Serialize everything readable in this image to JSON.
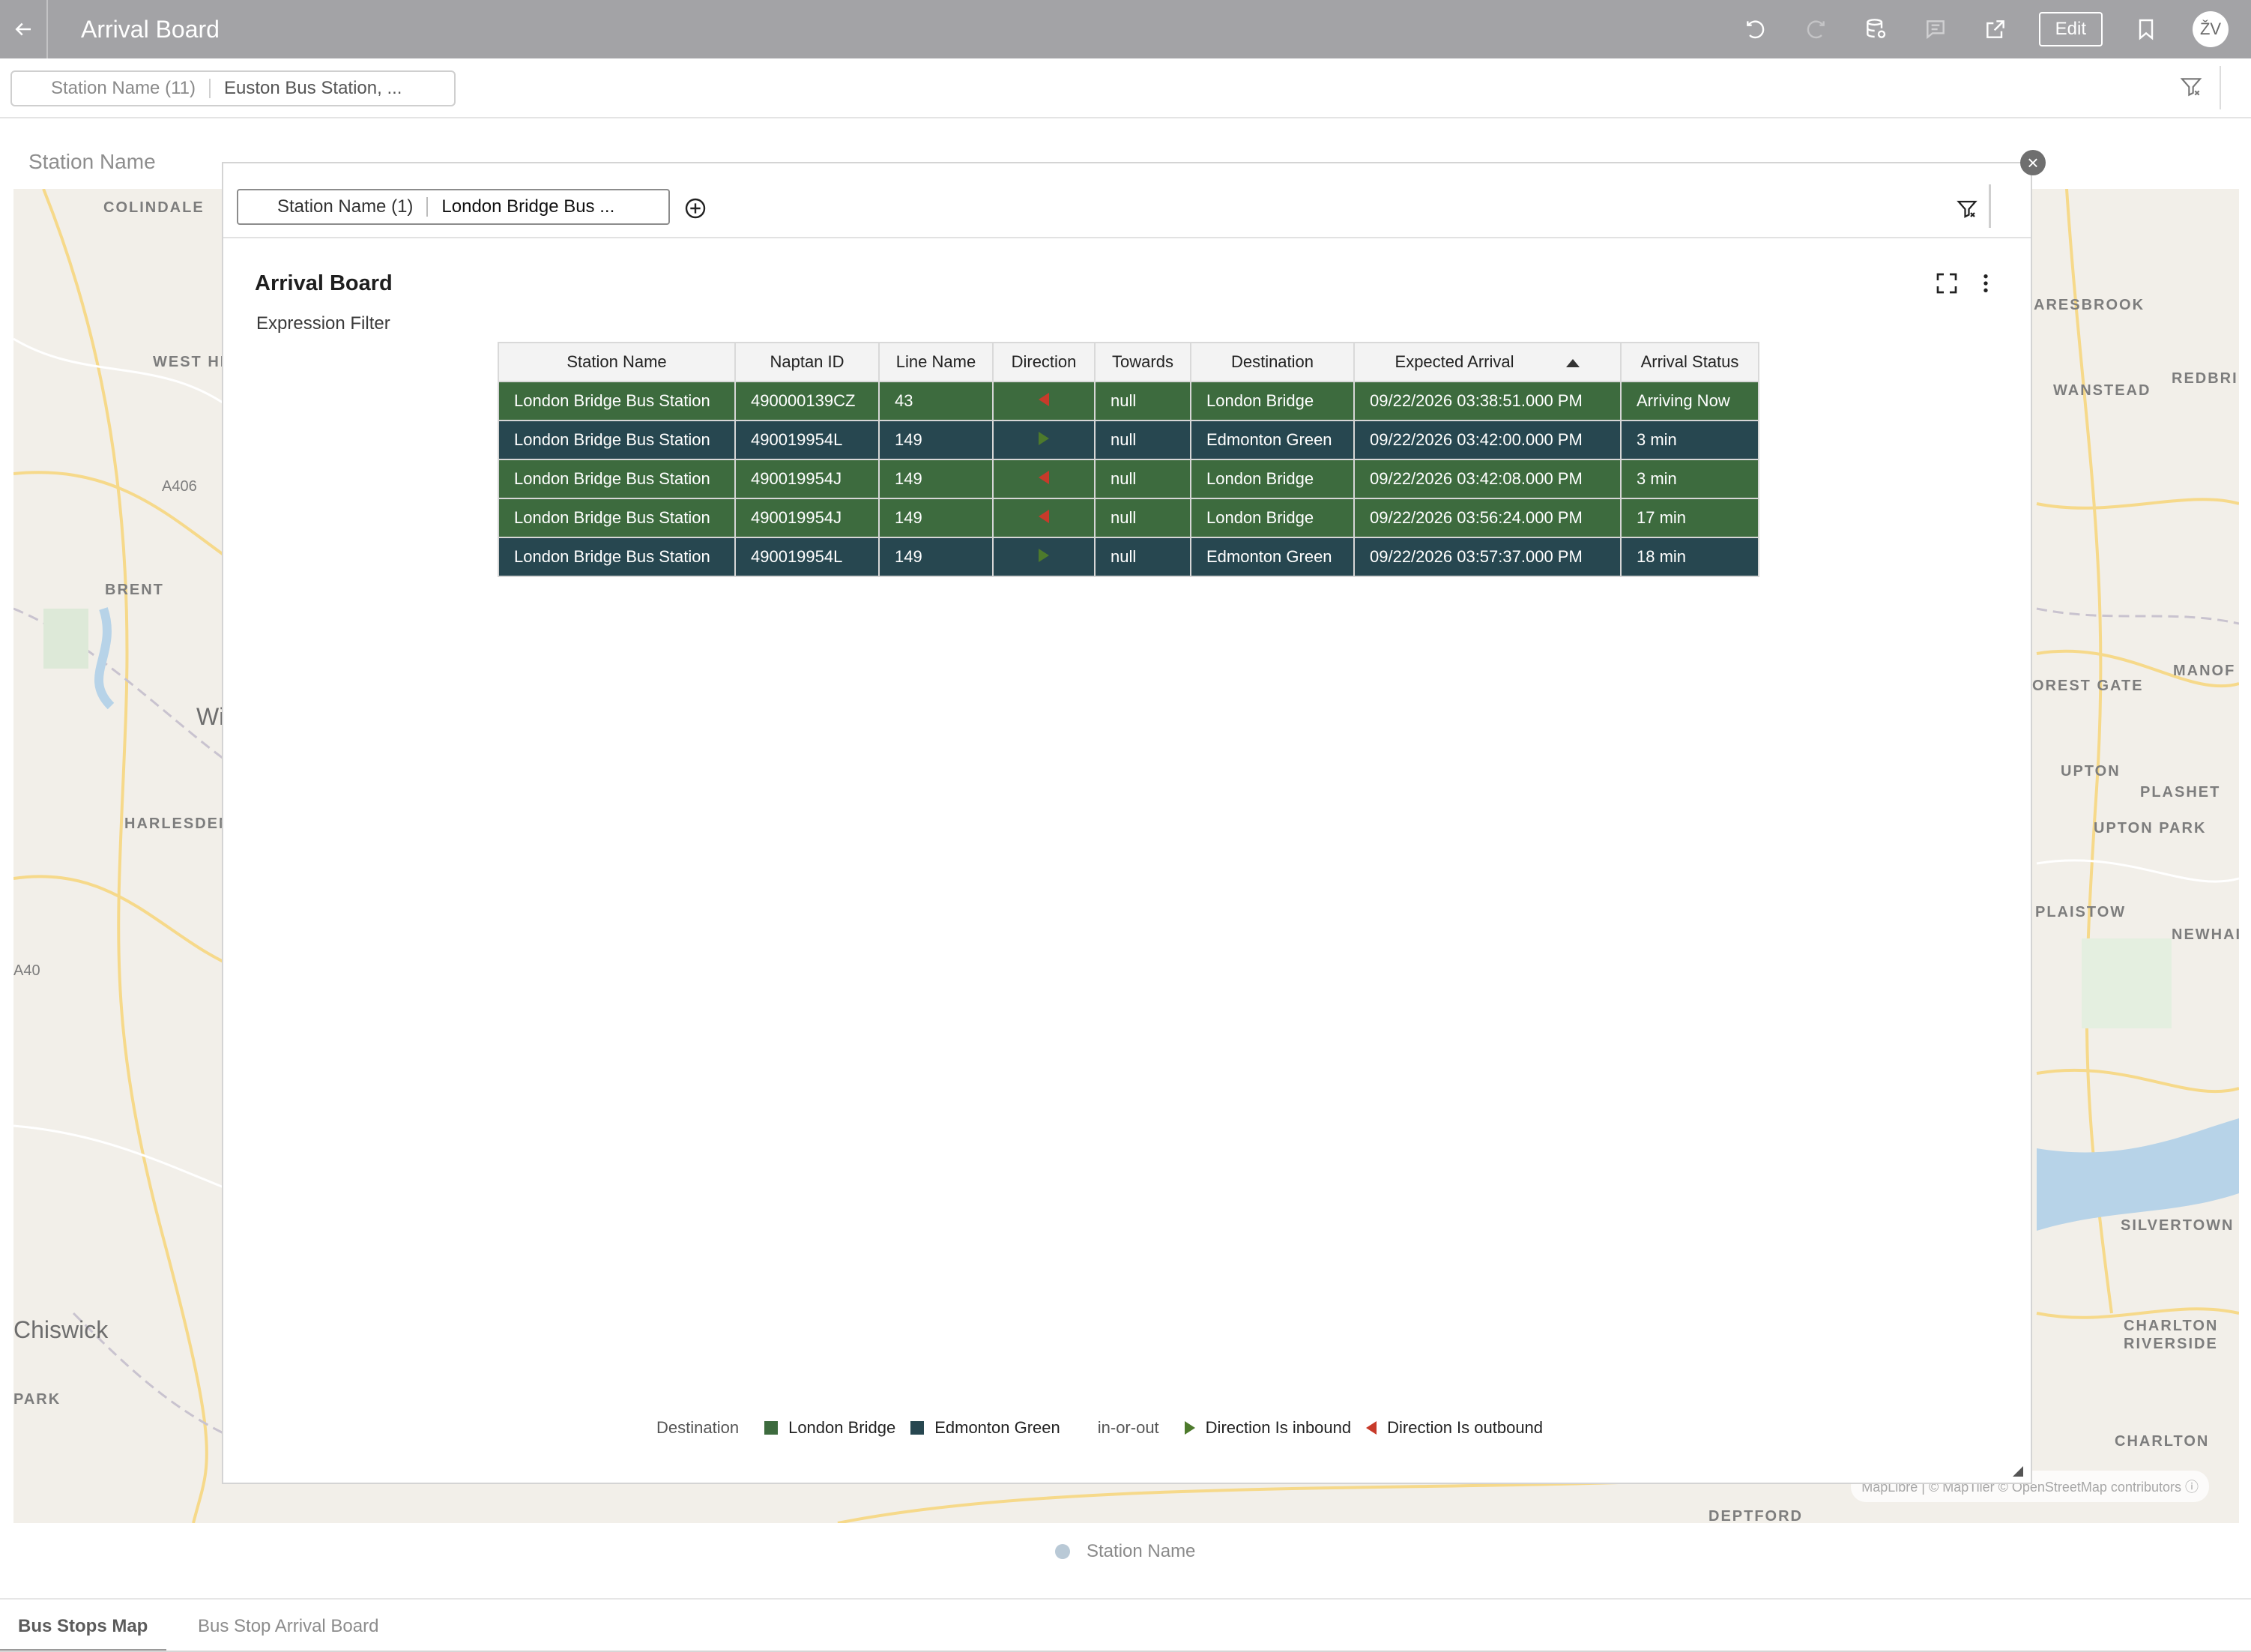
{
  "header": {
    "title": "Arrival Board",
    "edit_label": "Edit",
    "avatar_initials": "ŽV"
  },
  "page_filter": {
    "name": "Station Name (11)",
    "value": "Euston Bus Station, ..."
  },
  "canvas": {
    "title": "Station Name",
    "legend_label": "Station Name",
    "attribution": "MapLibre | © MapTiler  © OpenStreetMap contributors"
  },
  "map_labels": [
    "COLINDALE",
    "WEST HI",
    "A406",
    "BRENT",
    "Wi",
    "HARLESDEN",
    "A40",
    "Chiswick",
    "PARK",
    "ARESBROOK",
    "WANSTEAD",
    "REDBRI",
    "MANOF",
    "OREST GATE",
    "UPTON",
    "PLASHET",
    "UPTON PARK",
    "PLAISTOW",
    "NEWHAI",
    "SILVERTOWN",
    "CHARLTON",
    "RIVERSIDE",
    "CHARLTON",
    "DEPTFORD"
  ],
  "popup": {
    "filter_name": "Station Name (1)",
    "filter_value": "London Bridge Bus ...",
    "viz_title": "Arrival Board",
    "viz_subtitle": "Expression Filter"
  },
  "table": {
    "columns": [
      "Station Name",
      "Naptan ID",
      "Line Name",
      "Direction",
      "Towards",
      "Destination",
      "Expected Arrival",
      "Arrival Status"
    ],
    "sorted_column": "Expected Arrival",
    "rows": [
      {
        "station": "London Bridge Bus Station",
        "naptan": "490000139CZ",
        "line": "43",
        "direction": "outbound",
        "towards": "null",
        "destination": "London Bridge",
        "expected": "09/22/2026 03:38:51.000 PM",
        "status": "Arriving Now"
      },
      {
        "station": "London Bridge Bus Station",
        "naptan": "490019954L",
        "line": "149",
        "direction": "inbound",
        "towards": "null",
        "destination": "Edmonton Green",
        "expected": "09/22/2026 03:42:00.000 PM",
        "status": "3 min"
      },
      {
        "station": "London Bridge Bus Station",
        "naptan": "490019954J",
        "line": "149",
        "direction": "outbound",
        "towards": "null",
        "destination": "London Bridge",
        "expected": "09/22/2026 03:42:08.000 PM",
        "status": "3 min"
      },
      {
        "station": "London Bridge Bus Station",
        "naptan": "490019954J",
        "line": "149",
        "direction": "outbound",
        "towards": "null",
        "destination": "London Bridge",
        "expected": "09/22/2026 03:56:24.000 PM",
        "status": "17 min"
      },
      {
        "station": "London Bridge Bus Station",
        "naptan": "490019954L",
        "line": "149",
        "direction": "inbound",
        "towards": "null",
        "destination": "Edmonton Green",
        "expected": "09/22/2026 03:57:37.000 PM",
        "status": "18 min"
      }
    ]
  },
  "legend": {
    "destination_title": "Destination",
    "dest_items": [
      {
        "label": "London Bridge",
        "color": "#3d6b3e"
      },
      {
        "label": "Edmonton Green",
        "color": "#274750"
      }
    ],
    "direction_title": "in-or-out",
    "dir_items": [
      {
        "label": "Direction Is inbound",
        "color": "#4d7a2c",
        "icon": "triangle-right-icon"
      },
      {
        "label": "Direction Is outbound",
        "color": "#c73a2a",
        "icon": "triangle-left-icon"
      }
    ]
  },
  "tabs": [
    {
      "label": "Bus Stops Map",
      "active": true
    },
    {
      "label": "Bus Stop Arrival Board",
      "active": false
    }
  ],
  "colors": {
    "header_bg": "#a3a3a6",
    "row_london_bridge": "#3d6b3e",
    "row_edmonton_green": "#274750",
    "inbound": "#4d7a2c",
    "outbound": "#c73a2a"
  }
}
